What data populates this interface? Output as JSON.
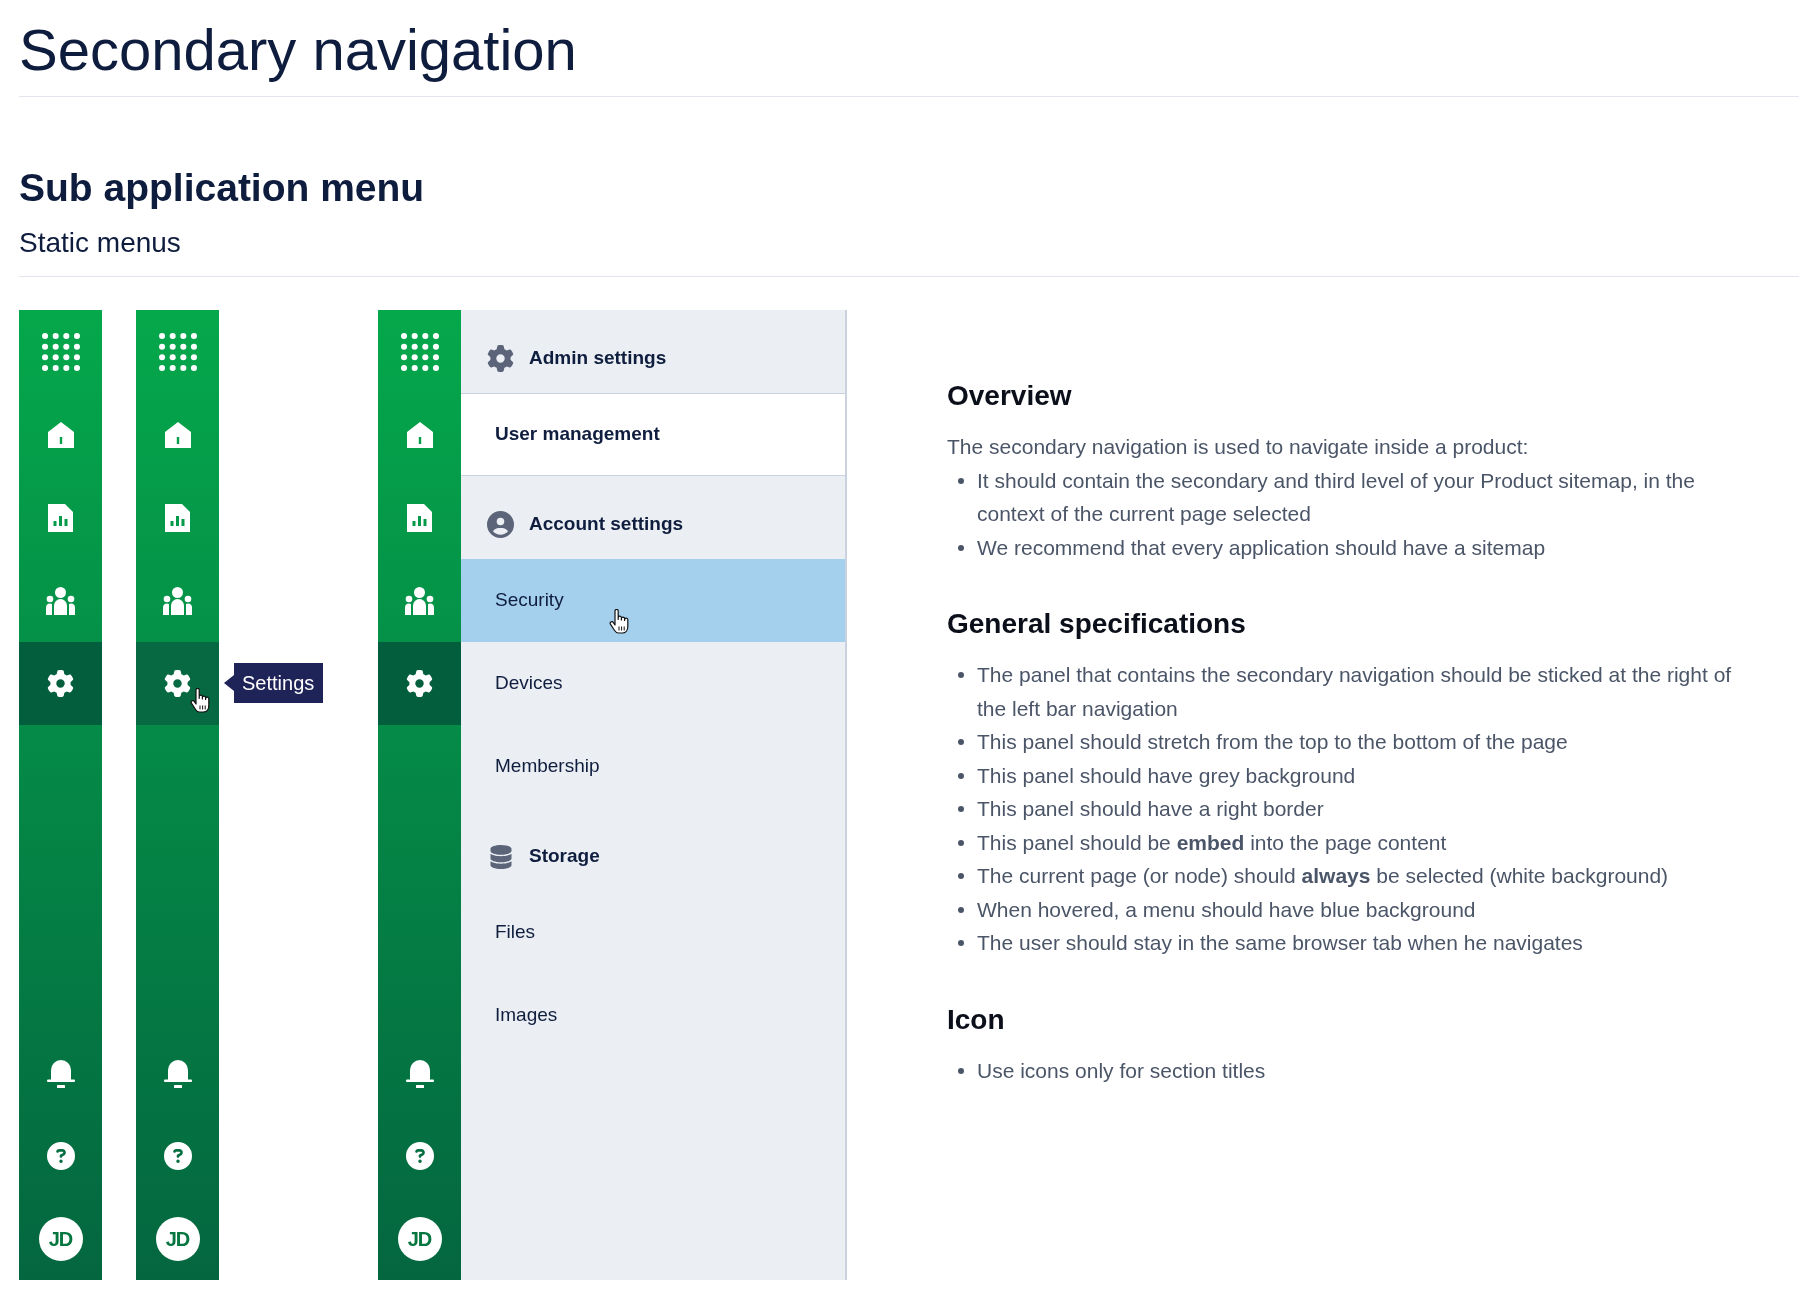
{
  "page": {
    "title": "Secondary navigation"
  },
  "section": {
    "title": "Sub application menu",
    "subtitle": "Static menus"
  },
  "rails": [
    {
      "items": [
        {
          "selected": false,
          "hovered": false
        },
        {
          "selected": false,
          "hovered": false
        },
        {
          "selected": false,
          "hovered": false
        },
        {
          "selected": false,
          "hovered": false
        },
        {
          "selected": true,
          "hovered": false
        }
      ],
      "avatar": {
        "initials": "JD"
      }
    },
    {
      "items": [
        {
          "selected": false,
          "hovered": false
        },
        {
          "selected": false,
          "hovered": false
        },
        {
          "selected": false,
          "hovered": false
        },
        {
          "selected": false,
          "hovered": false
        },
        {
          "selected": true,
          "hovered": true,
          "tooltip": "Settings"
        }
      ],
      "avatar": {
        "initials": "JD"
      }
    },
    {
      "items": [
        {
          "selected": false,
          "hovered": false
        },
        {
          "selected": false,
          "hovered": false
        },
        {
          "selected": false,
          "hovered": false
        },
        {
          "selected": false,
          "hovered": false
        },
        {
          "selected": true,
          "hovered": false
        }
      ],
      "avatar": {
        "initials": "JD"
      },
      "panel": {
        "sections": [
          {
            "title": "Admin settings",
            "items": [
              {
                "label": "User management",
                "selected": true,
                "hovered": false
              }
            ]
          },
          {
            "title": "Account settings",
            "items": [
              {
                "label": "Security",
                "selected": false,
                "hovered": true
              },
              {
                "label": "Devices",
                "selected": false,
                "hovered": false
              },
              {
                "label": "Membership",
                "selected": false,
                "hovered": false
              }
            ]
          },
          {
            "title": "Storage",
            "items": [
              {
                "label": "Files",
                "selected": false,
                "hovered": false
              },
              {
                "label": "Images",
                "selected": false,
                "hovered": false
              }
            ]
          }
        ]
      }
    }
  ],
  "docs": [
    {
      "heading": "Overview",
      "text": "The secondary navigation is used to navigate inside a product:",
      "bullets": [
        "It should contain the secondary and third level of your Product sitemap, in the context of the current page selected",
        "We recommend that every application should have a sitemap"
      ]
    },
    {
      "heading": "General specifications",
      "bullets": [
        "The panel that contains the secondary navigation should be sticked at the right of the left bar navigation",
        "This panel should stretch from the top to the bottom of the page",
        "This panel should have grey background",
        "This panel should have a right border",
        "This panel should be **embed** into the page content",
        "The current page (or node) should **always** be selected (white background)",
        "When hovered, a menu should have blue background",
        "The user should stay in the same browser tab when he navigates"
      ]
    },
    {
      "heading": "Icon",
      "bullets": [
        "Use icons only for section titles"
      ]
    }
  ]
}
